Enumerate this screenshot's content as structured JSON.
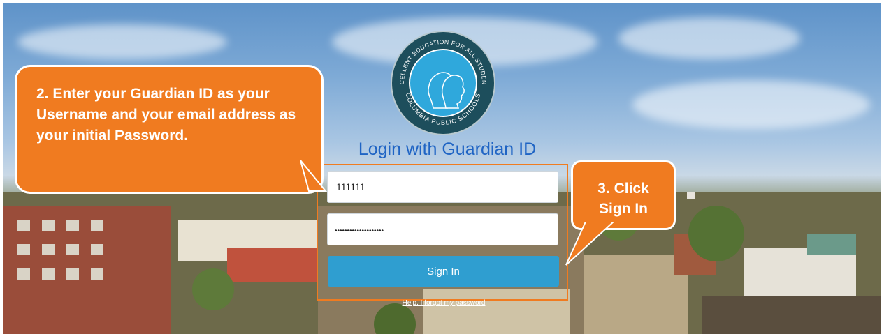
{
  "logo": {
    "arc_text_top": "EXCELLENT EDUCATION FOR ALL STUDENTS",
    "arc_text_bottom": "COLUMBIA PUBLIC SCHOOLS"
  },
  "login": {
    "title": "Login with Guardian ID",
    "username_value": "111111",
    "password_value": "••••••••••••••••••••",
    "sign_in_label": "Sign In",
    "forgot_link": "Help, I forgot my password"
  },
  "callouts": {
    "step2": "2. Enter your Guardian ID as your Username and your email address as your initial Password.",
    "step3": "3. Click Sign In"
  },
  "colors": {
    "callout_orange": "#f07b20",
    "title_blue": "#1f64c4",
    "button_blue": "#2f9ed0",
    "logo_teal": "#1d4e5c"
  }
}
